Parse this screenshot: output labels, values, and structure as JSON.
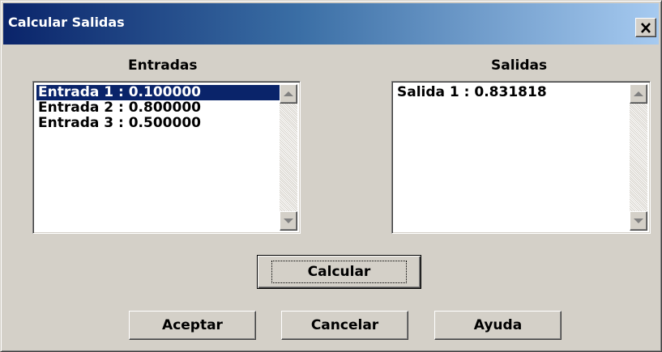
{
  "window": {
    "title": "Calcular Salidas",
    "close_glyph": "✕",
    "close_icon": "close-icon"
  },
  "entradas": {
    "label": "Entradas",
    "items": [
      "Entrada 1 : 0.100000",
      "Entrada 2 : 0.800000",
      "Entrada 3 : 0.500000"
    ],
    "selected_index": 0
  },
  "salidas": {
    "label": "Salidas",
    "items": [
      "Salida 1 : 0.831818"
    ]
  },
  "buttons": {
    "calcular": "Calcular",
    "aceptar": "Aceptar",
    "cancelar": "Cancelar",
    "ayuda": "Ayuda"
  },
  "colors": {
    "title_start": "#0a246a",
    "title_end": "#a6caf0",
    "face": "#d4d0c8",
    "selection": "#0a246a"
  }
}
